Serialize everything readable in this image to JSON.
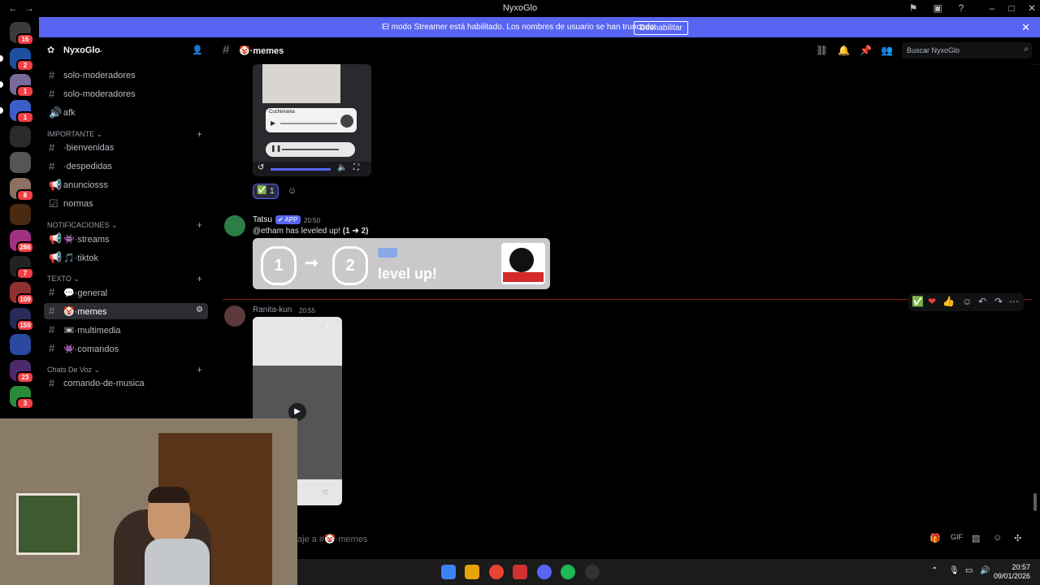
{
  "window": {
    "title": "NyxoGlo"
  },
  "colors": {
    "blurple": "#5865f2",
    "badge_red": "#f23f43",
    "bg": "#000000"
  },
  "rail": {
    "servers": [
      {
        "name": "direct-messages",
        "badge": "16",
        "color": "#3a3a3a"
      },
      {
        "name": "server-blue",
        "badge": "2",
        "color": "#1f4fa0"
      },
      {
        "name": "server-3",
        "badge": "1",
        "color": "#7a6a9a"
      },
      {
        "name": "server-4",
        "badge": "1",
        "color": "#3b5ec9"
      },
      {
        "name": "server-5",
        "badge": "",
        "color": "#2a2a2a"
      },
      {
        "name": "server-6",
        "badge": "",
        "color": "#555"
      },
      {
        "name": "server-7",
        "badge": "8",
        "color": "#8a7060"
      },
      {
        "name": "server-8",
        "badge": "",
        "color": "#4a2a10"
      },
      {
        "name": "server-9",
        "badge": "286",
        "color": "#a03080"
      },
      {
        "name": "server-10",
        "badge": "7",
        "color": "#222"
      },
      {
        "name": "server-11",
        "badge": "109",
        "color": "#903030"
      },
      {
        "name": "server-12",
        "badge": "159",
        "color": "#2a2a5a"
      },
      {
        "name": "server-13",
        "badge": "",
        "color": "#2a4aa0"
      },
      {
        "name": "server-14",
        "badge": "23",
        "color": "#4a2a6a"
      },
      {
        "name": "server-15",
        "badge": "3",
        "color": "#2a8a3a"
      }
    ]
  },
  "banner": {
    "message": "El modo Streamer está habilitado. Los nombres de usuario se han truncado.",
    "button": "Deshabilitar"
  },
  "sidebar": {
    "server_name": "NyxoGlo",
    "top_channels": [
      {
        "name": "solo-moderadores",
        "icon": "#"
      },
      {
        "name": "solo-moderadores",
        "icon": "#"
      },
      {
        "name": "afk",
        "icon": "🔊"
      }
    ],
    "categories": [
      {
        "name": "IMPORTANTE",
        "channels": [
          {
            "name": "·bienvenidas",
            "icon": "#"
          },
          {
            "name": "·despedidas",
            "icon": "#"
          },
          {
            "name": "anunciosss",
            "icon": "📢"
          },
          {
            "name": "normas",
            "icon": "☑"
          }
        ]
      },
      {
        "name": "NOTIFICACIONES",
        "channels": [
          {
            "name": "·streams",
            "icon": "📢",
            "emoji": "👾"
          },
          {
            "name": "·tiktok",
            "icon": "📢",
            "emoji": "🎵"
          }
        ]
      },
      {
        "name": "TEXTO",
        "channels": [
          {
            "name": "·general",
            "icon": "#",
            "emoji": "💬"
          },
          {
            "name": "·memes",
            "icon": "#",
            "emoji": "🤡",
            "active": true
          },
          {
            "name": "·multimedia",
            "icon": "#",
            "emoji": "📼"
          },
          {
            "name": "·comandos",
            "icon": "#",
            "emoji": "👾"
          }
        ]
      },
      {
        "name": "Chats De Voz",
        "channels": [
          {
            "name": "comando-de-musica",
            "icon": "#"
          }
        ]
      }
    ]
  },
  "header": {
    "channel": "·memes",
    "search_placeholder": "Buscar NyxoGlo"
  },
  "messages": {
    "first": {
      "audio_title": "Cuchimania",
      "reaction_count": "1"
    },
    "tatsu": {
      "username": "Tatsu",
      "app_tag": "APP",
      "time": "20:50",
      "text": "@etham has leveled up!",
      "bold": "(1 ➜ 2)",
      "level_from": "1",
      "level_to": "2",
      "card_text": "level up!"
    },
    "ranita": {
      "username": "Ranita-kun",
      "time": "20:55"
    }
  },
  "composer": {
    "placeholder": "aje a #🤡·memes"
  },
  "taskbar": {
    "time": "20:57",
    "date": "09/01/2026"
  }
}
